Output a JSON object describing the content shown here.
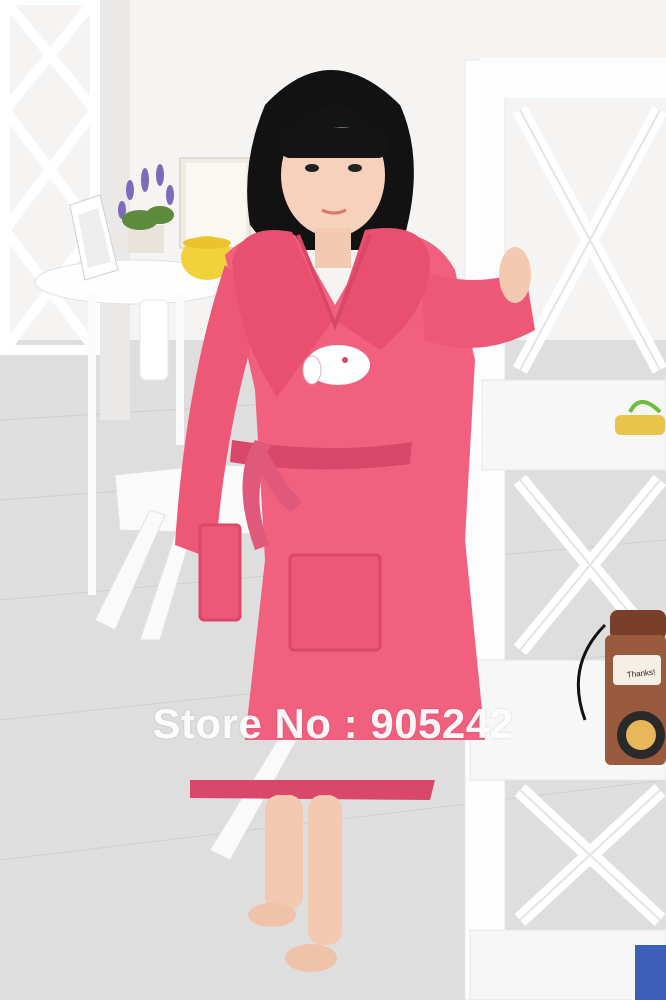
{
  "photo": {
    "subject": "girl-in-pink-hooded-bathrobe",
    "watermark_text": "Store No : 905242",
    "phone_sticker_text": "Thanks!",
    "colors": {
      "robe": "#f2607f",
      "robe_shadow": "#d94868",
      "wall": "#f4f2f0",
      "floor": "#dcdcdc",
      "furniture": "#fdfdfd",
      "phone": "#8a4b35",
      "hair": "#111111",
      "skin": "#f5cfb8"
    }
  }
}
